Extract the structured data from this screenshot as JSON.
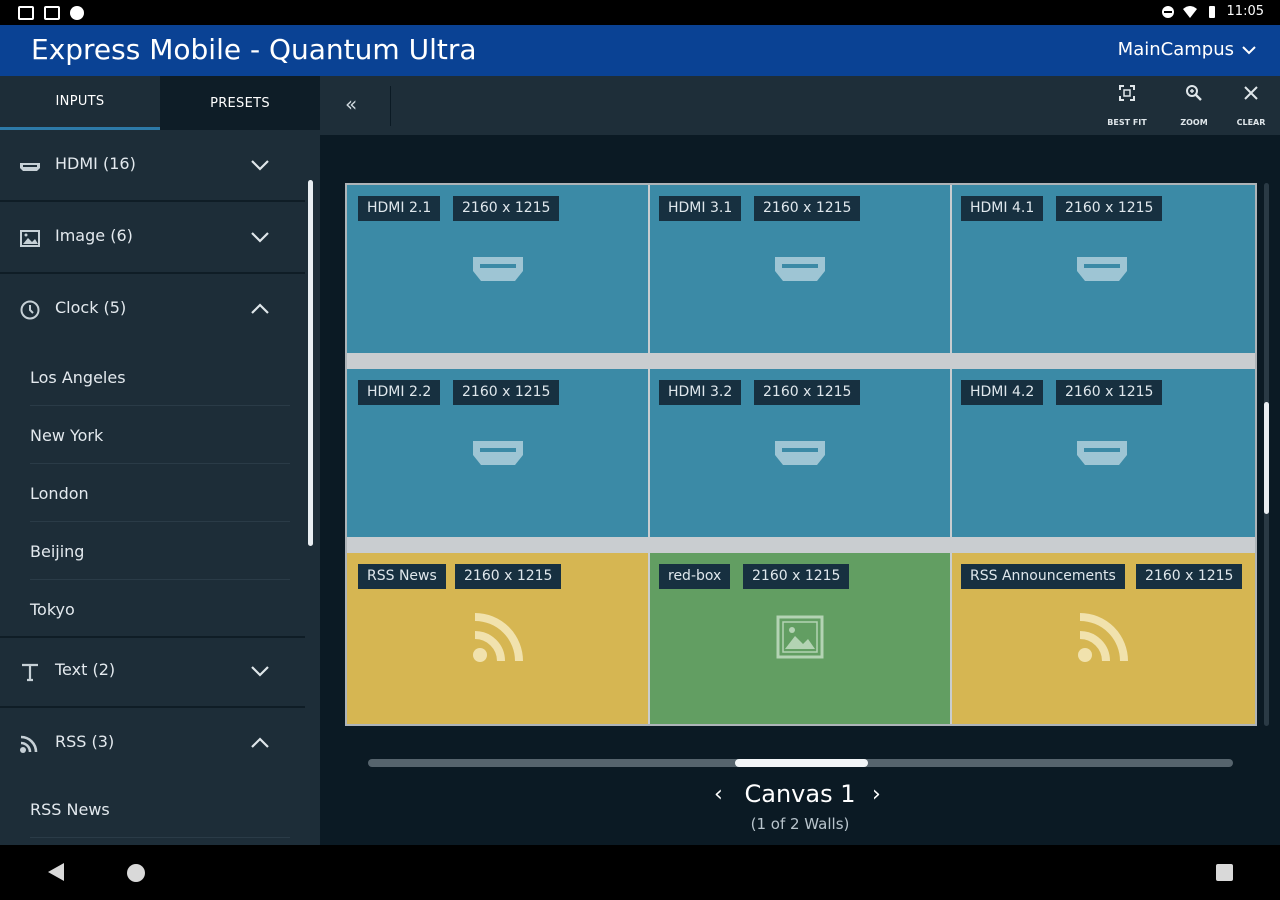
{
  "status_bar": {
    "time": "11:05"
  },
  "header": {
    "title": "Express Mobile - Quantum Ultra",
    "campus": "MainCampus",
    "color": "#0a4294"
  },
  "sidebar": {
    "tabs": [
      {
        "label": "INPUTS"
      },
      {
        "label": "PRESETS"
      }
    ],
    "groups": [
      {
        "label": "HDMI (16)",
        "icon": "hdmi-icon",
        "expanded": false
      },
      {
        "label": "Image (6)",
        "icon": "image-icon",
        "expanded": false
      },
      {
        "label": "Clock (5)",
        "icon": "clock-icon",
        "expanded": true,
        "items": [
          "Los Angeles",
          "New York",
          "London",
          "Beijing",
          "Tokyo"
        ]
      },
      {
        "label": "Text (2)",
        "icon": "text-icon",
        "expanded": false
      },
      {
        "label": "RSS (3)",
        "icon": "rss-icon",
        "expanded": true,
        "items": [
          "RSS News"
        ]
      }
    ]
  },
  "toolbar": {
    "collapse": "«",
    "tools": [
      {
        "label": "BEST FIT"
      },
      {
        "label": "ZOOM"
      },
      {
        "label": "CLEAR"
      }
    ]
  },
  "canvas": {
    "cells": [
      {
        "name": "HDMI 2.1",
        "res": "2160 x 1215",
        "type": "hdmi"
      },
      {
        "name": "HDMI 3.1",
        "res": "2160 x 1215",
        "type": "hdmi"
      },
      {
        "name": "HDMI 4.1",
        "res": "2160 x 1215",
        "type": "hdmi"
      },
      {
        "name": "HDMI 2.2",
        "res": "2160 x 1215",
        "type": "hdmi"
      },
      {
        "name": "HDMI 3.2",
        "res": "2160 x 1215",
        "type": "hdmi"
      },
      {
        "name": "HDMI 4.2",
        "res": "2160 x 1215",
        "type": "hdmi"
      },
      {
        "name": "RSS News",
        "res": "2160 x 1215",
        "type": "rss"
      },
      {
        "name": "red-box",
        "res": "2160 x 1215",
        "type": "img"
      },
      {
        "name": "RSS Announcements",
        "res": "2160 x 1215",
        "type": "rss"
      }
    ],
    "title": "Canvas 1",
    "subtitle": "(1 of 2 Walls)",
    "prev": "‹",
    "next": "›"
  }
}
